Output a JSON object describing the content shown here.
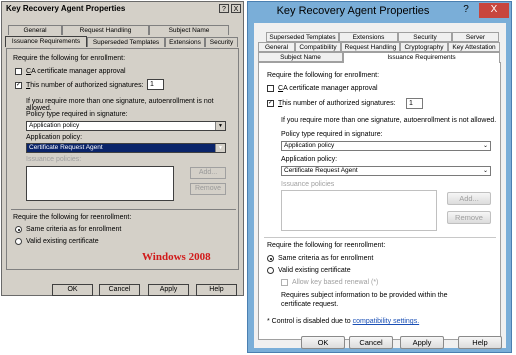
{
  "left": {
    "title": "Key Recovery Agent Properties",
    "caption_help": "?",
    "caption_close": "X",
    "tabs_row1": [
      "General",
      "Request Handling",
      "Subject Name"
    ],
    "tabs_row2": [
      "Issuance Requirements",
      "Superseded Templates",
      "Extensions",
      "Security"
    ],
    "require_label": "Require the following for enrollment:",
    "ca_approval": "CA certificate manager approval",
    "auth_sigs_label": "This number of authorized signatures:",
    "auth_sigs_value": "1",
    "auth_sigs_note": "If you require more than one signature, autoenrollment is not allowed.",
    "policy_type_label": "Policy type required in signature:",
    "policy_type_value": "Application policy",
    "app_policy_label": "Application policy:",
    "app_policy_value": "Certificate Request Agent",
    "issuance_label": "Issuance policies:",
    "add_btn": "Add...",
    "remove_btn": "Remove",
    "reenroll_label": "Require the following for reenrollment:",
    "same_criteria": "Same criteria as for enrollment",
    "valid_existing": "Valid existing certificate",
    "watermark": "Windows 2008",
    "ok": "OK",
    "cancel": "Cancel",
    "apply": "Apply",
    "help": "Help"
  },
  "right": {
    "title": "Key Recovery Agent Properties",
    "caption_help": "?",
    "caption_close": "X",
    "tabs_row1": [
      "Superseded Templates",
      "Extensions",
      "Security",
      "Server"
    ],
    "tabs_row2": [
      "General",
      "Compatibility",
      "Request Handling",
      "Cryptography",
      "Key Attestation"
    ],
    "tabs_row3": [
      "Subject Name",
      "Issuance Requirements"
    ],
    "require_label": "Require the following for enrollment:",
    "ca_approval": "CA certificate manager approval",
    "auth_sigs_label": "This number of authorized signatures:",
    "auth_sigs_value": "1",
    "auth_sigs_note": "If you require more than one signature, autoenrollment is not allowed.",
    "policy_type_label": "Policy type required in signature:",
    "policy_type_value": "Application policy",
    "app_policy_label": "Application policy:",
    "app_policy_value": "Certificate Request Agent",
    "issuance_label": "Issuance policies",
    "add_btn": "Add...",
    "remove_btn": "Remove",
    "reenroll_label": "Require the following for reenrollment:",
    "same_criteria": "Same criteria as for enrollment",
    "valid_existing": "Valid existing certificate",
    "allow_key_renewal": "Allow key based renewal (*)",
    "subject_info_note": "Requires subject information to be provided within the certificate request.",
    "control_note_prefix": "* Control is disabled due to ",
    "control_note_link": "compatibility settings.",
    "ok": "OK",
    "cancel": "Cancel",
    "apply": "Apply",
    "help": "Help"
  },
  "colors": {
    "classic_face": "#d4d0c8",
    "selection_blue": "#0a246a",
    "watermark_red": "#d11a1a",
    "modern_frame": "#7aaed8",
    "close_red": "#c8463e"
  },
  "icons": [
    "question-mark-icon",
    "close-icon",
    "dropdown-arrow-icon",
    "checkbox-checked-icon",
    "radio-selected-icon"
  ]
}
